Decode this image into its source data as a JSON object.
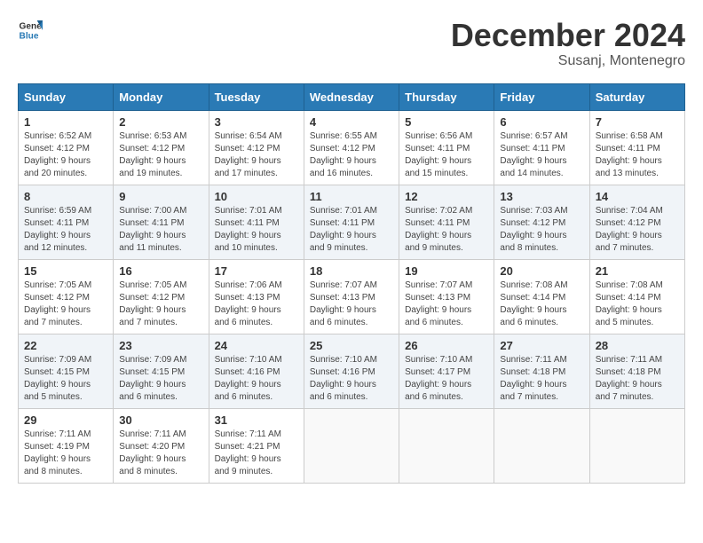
{
  "logo": {
    "general": "General",
    "blue": "Blue"
  },
  "title": "December 2024",
  "location": "Susanj, Montenegro",
  "days_header": [
    "Sunday",
    "Monday",
    "Tuesday",
    "Wednesday",
    "Thursday",
    "Friday",
    "Saturday"
  ],
  "weeks": [
    [
      {
        "day": "1",
        "sunrise": "6:52 AM",
        "sunset": "4:12 PM",
        "daylight": "9 hours and 20 minutes."
      },
      {
        "day": "2",
        "sunrise": "6:53 AM",
        "sunset": "4:12 PM",
        "daylight": "9 hours and 19 minutes."
      },
      {
        "day": "3",
        "sunrise": "6:54 AM",
        "sunset": "4:12 PM",
        "daylight": "9 hours and 17 minutes."
      },
      {
        "day": "4",
        "sunrise": "6:55 AM",
        "sunset": "4:12 PM",
        "daylight": "9 hours and 16 minutes."
      },
      {
        "day": "5",
        "sunrise": "6:56 AM",
        "sunset": "4:11 PM",
        "daylight": "9 hours and 15 minutes."
      },
      {
        "day": "6",
        "sunrise": "6:57 AM",
        "sunset": "4:11 PM",
        "daylight": "9 hours and 14 minutes."
      },
      {
        "day": "7",
        "sunrise": "6:58 AM",
        "sunset": "4:11 PM",
        "daylight": "9 hours and 13 minutes."
      }
    ],
    [
      {
        "day": "8",
        "sunrise": "6:59 AM",
        "sunset": "4:11 PM",
        "daylight": "9 hours and 12 minutes."
      },
      {
        "day": "9",
        "sunrise": "7:00 AM",
        "sunset": "4:11 PM",
        "daylight": "9 hours and 11 minutes."
      },
      {
        "day": "10",
        "sunrise": "7:01 AM",
        "sunset": "4:11 PM",
        "daylight": "9 hours and 10 minutes."
      },
      {
        "day": "11",
        "sunrise": "7:01 AM",
        "sunset": "4:11 PM",
        "daylight": "9 hours and 9 minutes."
      },
      {
        "day": "12",
        "sunrise": "7:02 AM",
        "sunset": "4:11 PM",
        "daylight": "9 hours and 9 minutes."
      },
      {
        "day": "13",
        "sunrise": "7:03 AM",
        "sunset": "4:12 PM",
        "daylight": "9 hours and 8 minutes."
      },
      {
        "day": "14",
        "sunrise": "7:04 AM",
        "sunset": "4:12 PM",
        "daylight": "9 hours and 7 minutes."
      }
    ],
    [
      {
        "day": "15",
        "sunrise": "7:05 AM",
        "sunset": "4:12 PM",
        "daylight": "9 hours and 7 minutes."
      },
      {
        "day": "16",
        "sunrise": "7:05 AM",
        "sunset": "4:12 PM",
        "daylight": "9 hours and 7 minutes."
      },
      {
        "day": "17",
        "sunrise": "7:06 AM",
        "sunset": "4:13 PM",
        "daylight": "9 hours and 6 minutes."
      },
      {
        "day": "18",
        "sunrise": "7:07 AM",
        "sunset": "4:13 PM",
        "daylight": "9 hours and 6 minutes."
      },
      {
        "day": "19",
        "sunrise": "7:07 AM",
        "sunset": "4:13 PM",
        "daylight": "9 hours and 6 minutes."
      },
      {
        "day": "20",
        "sunrise": "7:08 AM",
        "sunset": "4:14 PM",
        "daylight": "9 hours and 6 minutes."
      },
      {
        "day": "21",
        "sunrise": "7:08 AM",
        "sunset": "4:14 PM",
        "daylight": "9 hours and 5 minutes."
      }
    ],
    [
      {
        "day": "22",
        "sunrise": "7:09 AM",
        "sunset": "4:15 PM",
        "daylight": "9 hours and 5 minutes."
      },
      {
        "day": "23",
        "sunrise": "7:09 AM",
        "sunset": "4:15 PM",
        "daylight": "9 hours and 6 minutes."
      },
      {
        "day": "24",
        "sunrise": "7:10 AM",
        "sunset": "4:16 PM",
        "daylight": "9 hours and 6 minutes."
      },
      {
        "day": "25",
        "sunrise": "7:10 AM",
        "sunset": "4:16 PM",
        "daylight": "9 hours and 6 minutes."
      },
      {
        "day": "26",
        "sunrise": "7:10 AM",
        "sunset": "4:17 PM",
        "daylight": "9 hours and 6 minutes."
      },
      {
        "day": "27",
        "sunrise": "7:11 AM",
        "sunset": "4:18 PM",
        "daylight": "9 hours and 7 minutes."
      },
      {
        "day": "28",
        "sunrise": "7:11 AM",
        "sunset": "4:18 PM",
        "daylight": "9 hours and 7 minutes."
      }
    ],
    [
      {
        "day": "29",
        "sunrise": "7:11 AM",
        "sunset": "4:19 PM",
        "daylight": "9 hours and 8 minutes."
      },
      {
        "day": "30",
        "sunrise": "7:11 AM",
        "sunset": "4:20 PM",
        "daylight": "9 hours and 8 minutes."
      },
      {
        "day": "31",
        "sunrise": "7:11 AM",
        "sunset": "4:21 PM",
        "daylight": "9 hours and 9 minutes."
      },
      null,
      null,
      null,
      null
    ]
  ]
}
